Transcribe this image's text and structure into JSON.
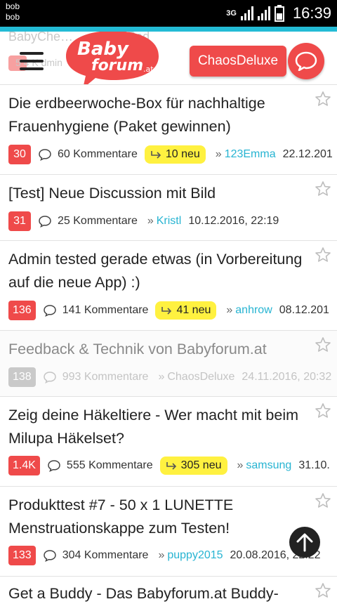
{
  "status_bar": {
    "carrier_line1": "bob",
    "carrier_line2": "bob",
    "network": "3G",
    "time": "16:39"
  },
  "header": {
    "ghost_title": "BabyChe…                    …e und iPad",
    "ghost_meta": "5      4 K                                    dmin",
    "logo_line1": "Baby",
    "logo_line2": "forum",
    "logo_tld": ".at",
    "user_button": "ChaosDeluxe"
  },
  "discussions": [
    {
      "title": "Die erdbeerwoche-Box für nachhaltige Frauenhygiene (Paket gewinnen)",
      "badge": "30",
      "comments": "60 Kommentare",
      "new": "10 neu",
      "user": "123Emma",
      "date": "22.12.201"
    },
    {
      "title": "[Test] Neue Discussion mit Bild",
      "badge": "31",
      "comments": "25 Kommentare",
      "user": "Kristl",
      "date": "10.12.2016, 22:19"
    },
    {
      "title": "Admin tested gerade etwas (in Vorbereitung auf die neue App) :)",
      "badge": "136",
      "comments": "141 Kommentare",
      "new": "41 neu",
      "user": "anhrow",
      "date": "08.12.201"
    },
    {
      "title": "Feedback & Technik von Babyforum.at",
      "badge": "138",
      "comments": "993 Kommentare",
      "user": "ChaosDeluxe",
      "date": "24.11.2016, 20:32"
    },
    {
      "title": "Zeig deine Häkeltiere - Wer macht mit beim Milupa Häkelset?",
      "badge": "1.4K",
      "comments": "555 Kommentare",
      "new": "305 neu",
      "user": "samsung",
      "date": "31.10."
    },
    {
      "title": "Produkttest #7 - 50 x 1 LUNETTE Menstruationskappe zum Testen!",
      "badge": "133",
      "comments": "304 Kommentare",
      "user": "puppy2015",
      "date": "20.08.2016, 22:22"
    },
    {
      "title": "Get a Buddy - Das Babyforum.at Buddy-"
    }
  ],
  "raquo": "»",
  "colors": {
    "accent": "#23bbd5",
    "brand_red": "#ef4a4a",
    "new_highlight": "#fff140",
    "user_link": "#27b4d2"
  }
}
